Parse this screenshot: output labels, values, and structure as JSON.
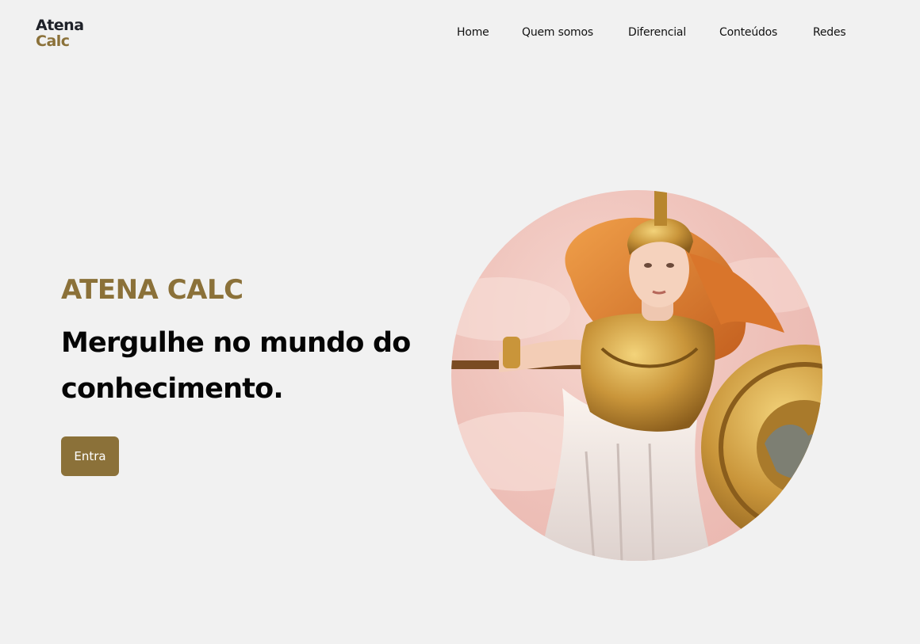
{
  "brand": {
    "line1": "Atena",
    "line2": "Calc"
  },
  "nav": {
    "items": [
      {
        "label": "Home"
      },
      {
        "label": "Quem somos"
      },
      {
        "label": "Diferencial"
      },
      {
        "label": "Conteúdos"
      },
      {
        "label": "Redes"
      }
    ]
  },
  "hero": {
    "eyebrow": "ATENA CALC",
    "headline": "Mergulhe no mundo do conhecimento.",
    "cta_label": "Entra"
  },
  "colors": {
    "background": "#f1f1f1",
    "accent": "#8b7139",
    "text": "#050505"
  }
}
